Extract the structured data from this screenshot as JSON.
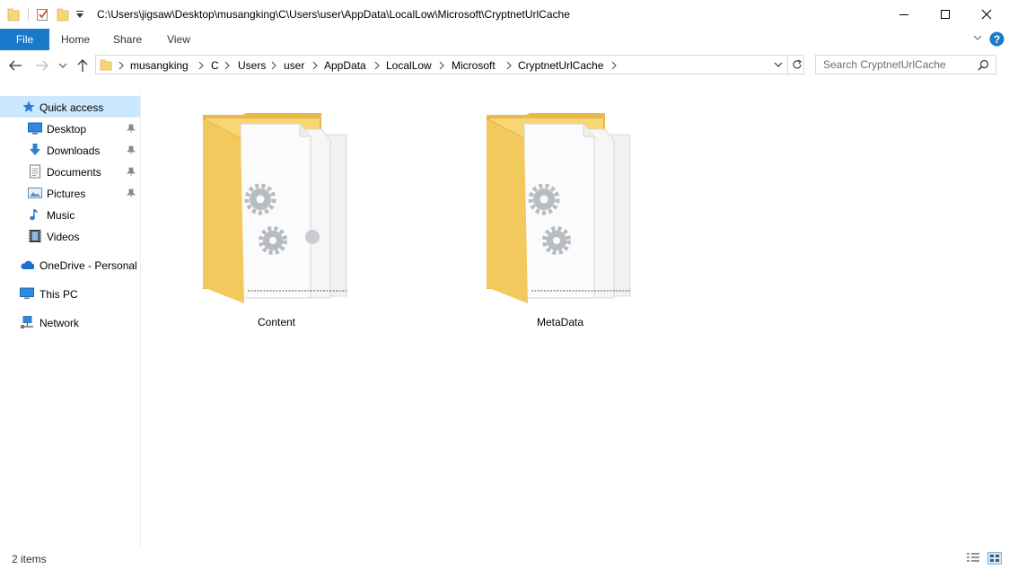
{
  "window": {
    "title": "C:\\Users\\jigsaw\\Desktop\\musangking\\C\\Users\\user\\AppData\\LocalLow\\Microsoft\\CryptnetUrlCache"
  },
  "ribbon": {
    "tabs": [
      {
        "label": "File"
      },
      {
        "label": "Home"
      },
      {
        "label": "Share"
      },
      {
        "label": "View"
      }
    ]
  },
  "address": {
    "crumbs": [
      "musangking",
      "C",
      "Users",
      "user",
      "AppData",
      "LocalLow",
      "Microsoft",
      "CryptnetUrlCache"
    ]
  },
  "search": {
    "placeholder": "Search CryptnetUrlCache"
  },
  "sidebar": {
    "items": [
      {
        "label": "Quick access",
        "icon": "star-icon",
        "selected": true
      },
      {
        "label": "Desktop",
        "icon": "desktop-icon",
        "pinned": true
      },
      {
        "label": "Downloads",
        "icon": "download-icon",
        "pinned": true
      },
      {
        "label": "Documents",
        "icon": "documents-icon",
        "pinned": true
      },
      {
        "label": "Pictures",
        "icon": "pictures-icon",
        "pinned": true
      },
      {
        "label": "Music",
        "icon": "music-icon"
      },
      {
        "label": "Videos",
        "icon": "videos-icon"
      },
      {
        "label": "OneDrive - Personal",
        "icon": "cloud-icon"
      },
      {
        "label": "This PC",
        "icon": "computer-icon"
      },
      {
        "label": "Network",
        "icon": "network-icon"
      }
    ]
  },
  "content": {
    "folders": [
      {
        "name": "Content",
        "icon": "folder-with-gear-files-icon"
      },
      {
        "name": "MetaData",
        "icon": "folder-with-gear-files-icon"
      }
    ]
  },
  "status": {
    "item_count": "2 items"
  },
  "colors": {
    "accent": "#1979ca",
    "selected": "#cce8ff",
    "folder": "#f7d674"
  }
}
